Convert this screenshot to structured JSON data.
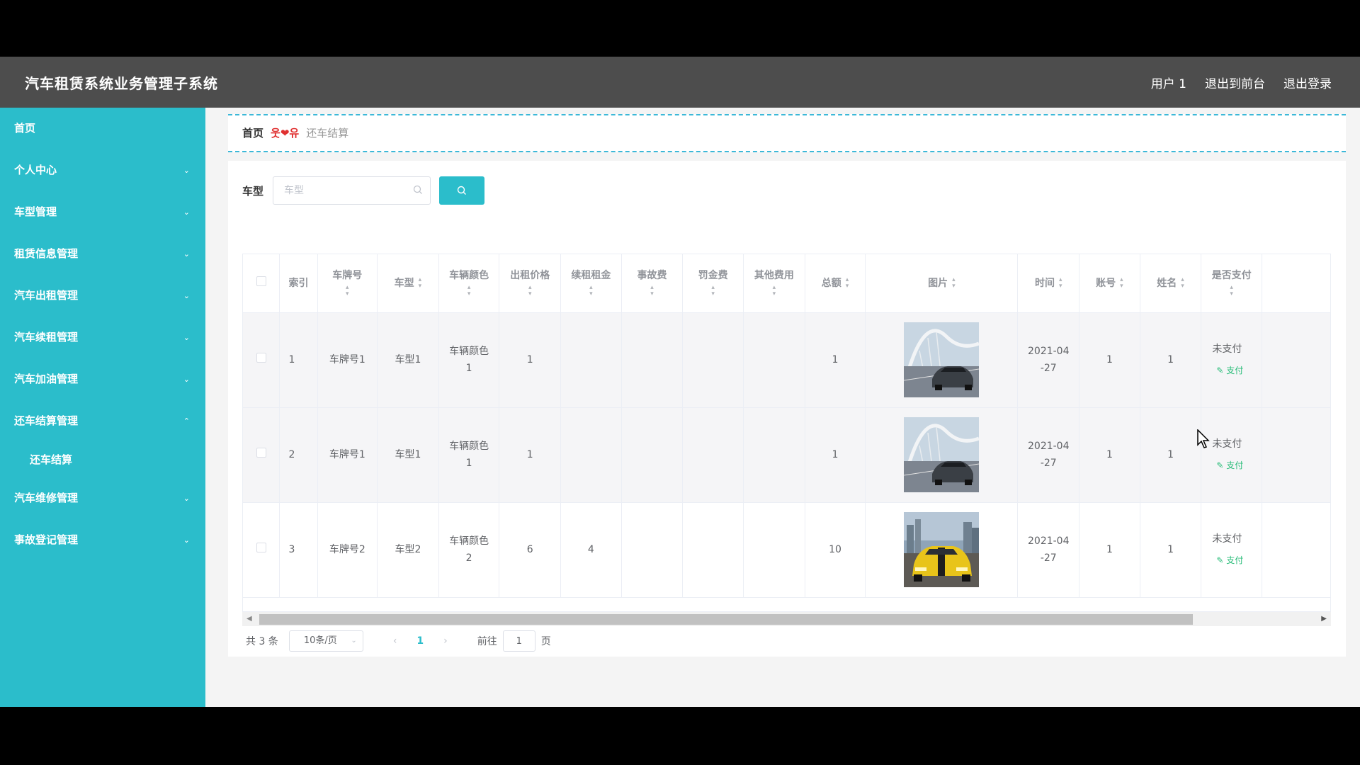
{
  "app": {
    "title": "汽车租赁系统业务管理子系统"
  },
  "header": {
    "user": "用户 1",
    "to_front": "退出到前台",
    "logout": "退出登录"
  },
  "sidebar": {
    "items": [
      {
        "label": "首页",
        "has_chevron": false
      },
      {
        "label": "个人中心",
        "has_chevron": true,
        "chevron": "⌄"
      },
      {
        "label": "车型管理",
        "has_chevron": true,
        "chevron": "⌄"
      },
      {
        "label": "租赁信息管理",
        "has_chevron": true,
        "chevron": "⌄"
      },
      {
        "label": "汽车出租管理",
        "has_chevron": true,
        "chevron": "⌄"
      },
      {
        "label": "汽车续租管理",
        "has_chevron": true,
        "chevron": "⌄"
      },
      {
        "label": "汽车加油管理",
        "has_chevron": true,
        "chevron": "⌄"
      },
      {
        "label": "还车结算管理",
        "has_chevron": true,
        "chevron": "⌃",
        "expanded": true,
        "children": [
          {
            "label": "还车结算"
          }
        ]
      },
      {
        "label": "汽车维修管理",
        "has_chevron": true,
        "chevron": "⌄"
      },
      {
        "label": "事故登记管理",
        "has_chevron": true,
        "chevron": "⌄"
      }
    ]
  },
  "breadcrumb": {
    "home": "首页",
    "separator": "웃❤유",
    "current": "还车结算"
  },
  "search": {
    "label": "车型",
    "placeholder": "车型",
    "value": "",
    "button_icon": "search-icon"
  },
  "table": {
    "columns": [
      {
        "key": "select",
        "label": "",
        "sortable": false
      },
      {
        "key": "index",
        "label": "索引",
        "sortable": false
      },
      {
        "key": "plate",
        "label": "车牌号",
        "sortable": true,
        "wrap": true
      },
      {
        "key": "model",
        "label": "车型",
        "sortable": true,
        "wrap": false
      },
      {
        "key": "color",
        "label": "车辆颜色",
        "sortable": true,
        "wrap": true
      },
      {
        "key": "rent_price",
        "label": "出租价格",
        "sortable": true,
        "wrap": true
      },
      {
        "key": "renew_rent",
        "label": "续租租金",
        "sortable": true,
        "wrap": true
      },
      {
        "key": "accident_fee",
        "label": "事故费",
        "sortable": true,
        "wrap": true
      },
      {
        "key": "fine",
        "label": "罚金费",
        "sortable": true,
        "wrap": true
      },
      {
        "key": "other_fee",
        "label": "其他费用",
        "sortable": true,
        "wrap": true
      },
      {
        "key": "total",
        "label": "总额",
        "sortable": true,
        "wrap": false
      },
      {
        "key": "image",
        "label": "图片",
        "sortable": true,
        "wrap": false
      },
      {
        "key": "time",
        "label": "时间",
        "sortable": true,
        "wrap": false
      },
      {
        "key": "account",
        "label": "账号",
        "sortable": true,
        "wrap": false
      },
      {
        "key": "name",
        "label": "姓名",
        "sortable": true,
        "wrap": false
      },
      {
        "key": "paid",
        "label": "是否支付",
        "sortable": true,
        "wrap": true
      },
      {
        "key": "extra",
        "label": "",
        "sortable": false
      }
    ],
    "rows": [
      {
        "index": "1",
        "plate": "车牌号1",
        "model": "车型1",
        "color": "车辆颜色1",
        "rent_price": "1",
        "renew_rent": "",
        "accident_fee": "",
        "fine": "",
        "other_fee": "",
        "total": "1",
        "image": "bridge-car-photo",
        "time": "2021-04-27",
        "account": "1",
        "name": "1",
        "paid": "未支付",
        "pay_action": "支付"
      },
      {
        "index": "2",
        "plate": "车牌号1",
        "model": "车型1",
        "color": "车辆颜色1",
        "rent_price": "1",
        "renew_rent": "",
        "accident_fee": "",
        "fine": "",
        "other_fee": "",
        "total": "1",
        "image": "bridge-car-photo",
        "time": "2021-04-27",
        "account": "1",
        "name": "1",
        "paid": "未支付",
        "pay_action": "支付"
      },
      {
        "index": "3",
        "plate": "车牌号2",
        "model": "车型2",
        "color": "车辆颜色2",
        "rent_price": "6",
        "renew_rent": "4",
        "accident_fee": "",
        "fine": "",
        "other_fee": "",
        "total": "10",
        "image": "yellow-car-photo",
        "time": "2021-04-27",
        "account": "1",
        "name": "1",
        "paid": "未支付",
        "pay_action": "支付"
      }
    ]
  },
  "pagination": {
    "total": "共 3 条",
    "page_size": "10条/页",
    "current_page": "1",
    "goto_label": "前往",
    "goto_value": "1",
    "page_suffix": "页"
  },
  "colors": {
    "accent": "#2bbdcb",
    "header_bg": "#4d4d4d",
    "pay_link": "#2bbd7a",
    "breadcrumb_separator": "#e03030"
  }
}
